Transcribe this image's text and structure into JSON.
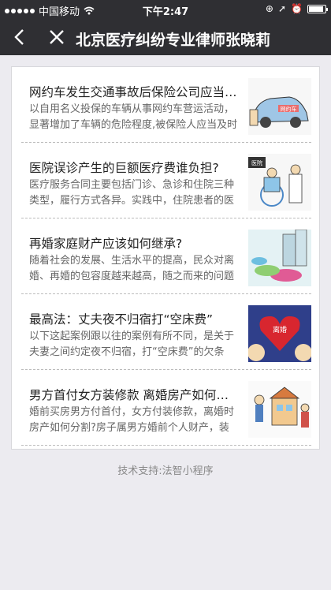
{
  "status_bar": {
    "carrier": "中国移动",
    "time": "下午2:47"
  },
  "nav": {
    "title": "北京医疗纠纷专业律师张晓莉"
  },
  "articles": [
    {
      "title": "网约车发生交通事故后保险公司应当赔偿吗？",
      "desc": "以自用名义投保的车辆从事网约车营运活动，显著增加了车辆的危险程度,被保险人应当及时通知保险人",
      "thumb_text": "网约车"
    },
    {
      "title": "医院误诊产生的巨额医疗费谁负担?",
      "desc": "医疗服务合同主要包括门诊、急诊和住院三种类型，履行方式各异。实践中，住院患者的医疗纠纷较多",
      "thumb_text": "医院"
    },
    {
      "title": "再婚家庭财产应该如何继承?",
      "desc": "随着社会的发展、生活水平的提高，民众对离婚、再婚的包容度越来越高，随之而来的问题也越来越多",
      "thumb_text": ""
    },
    {
      "title": "最高法：丈夫夜不归宿打“空床费”",
      "desc": "以下这起案例跟以往的案例有所不同，是关于夫妻之间约定夜不归宿，打“空床费”的欠条",
      "thumb_text": "离婚"
    },
    {
      "title": "男方首付女方装修款 离婚房产如何分割？",
      "desc": "婚前买房男方付首付，女方付装修款，离婚时房产如何分割?房子属男方婚前个人财产，装修款怎么办",
      "thumb_text": ""
    }
  ],
  "footer": {
    "text": "技术支持:法智小程序"
  }
}
